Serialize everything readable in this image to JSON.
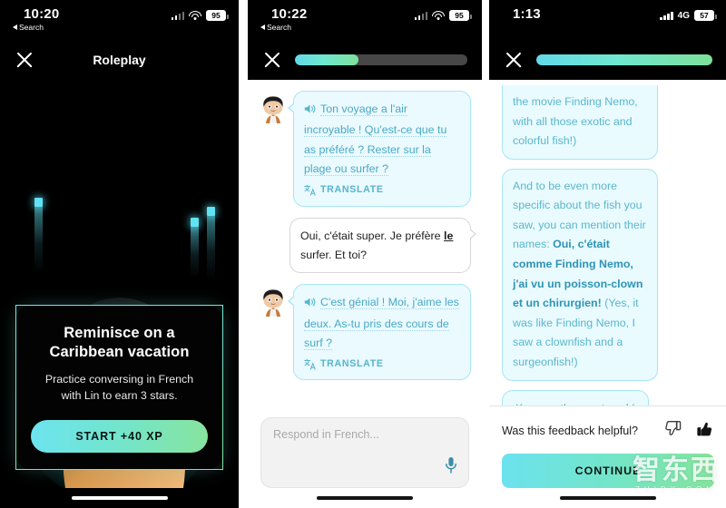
{
  "panel1": {
    "status": {
      "time": "10:20",
      "back_label": "Search",
      "battery": "95",
      "network": ""
    },
    "nav": {
      "close_icon": "close-icon",
      "title": "Roleplay"
    },
    "card": {
      "title_line1": "Reminisce on a",
      "title_line2": "Caribbean vacation",
      "subtitle_line1": "Practice conversing in French",
      "subtitle_line2": "with Lin to earn 3 stars.",
      "cta_label": "START +40 XP"
    },
    "accent": "#6ee3ef"
  },
  "panel2": {
    "status": {
      "time": "10:22",
      "back_label": "Search",
      "battery": "95",
      "network": ""
    },
    "nav": {
      "close_icon": "close-icon"
    },
    "progress_percent": 37,
    "messages": [
      {
        "sender": "bot",
        "speaker_icon": "speaker-icon",
        "text": "Ton voyage a l'air incroyable ! Qu'est-ce que tu as préféré ? Rester sur la plage ou surfer ?",
        "translate_label": "TRANSLATE",
        "translate_icon": "translate-icon"
      },
      {
        "sender": "me",
        "text_before": "Oui, c'était super. Je préfère ",
        "highlight": "le",
        "text_after": " surfer. Et toi?"
      },
      {
        "sender": "bot",
        "speaker_icon": "speaker-icon",
        "text": "C'est génial ! Moi, j'aime les deux. As-tu pris des cours de surf ?",
        "translate_label": "TRANSLATE",
        "translate_icon": "translate-icon"
      }
    ],
    "composer": {
      "placeholder": "Respond in French...",
      "mic_icon": "microphone-icon"
    }
  },
  "panel3": {
    "status": {
      "time": "1:13",
      "battery": "57",
      "network": "4G"
    },
    "nav": {
      "close_icon": "close-icon"
    },
    "progress_percent": 100,
    "bubble_clipped": "the movie Finding Nemo, with all those exotic and colorful fish!)",
    "bubble_main": {
      "part1": "And to be even more specific about the fish you saw, you can mention their names: ",
      "bold": "Oui, c'était comme Finding Nemo, j'ai vu un poisson-clown et un chirurgien!",
      "part2": " (Yes, it was like Finding Nemo, I saw a clownfish and a surgeonfish!)"
    },
    "bubble_praise": "Keep up the great work!",
    "feedback": {
      "question": "Was this feedback helpful?",
      "thumbs_down_icon": "thumbs-down-icon",
      "thumbs_up_icon": "thumbs-up-icon"
    },
    "continue_label": "CONTINUE"
  },
  "watermark": {
    "text": "智东西",
    "sub": "ZHIDX.COM"
  }
}
